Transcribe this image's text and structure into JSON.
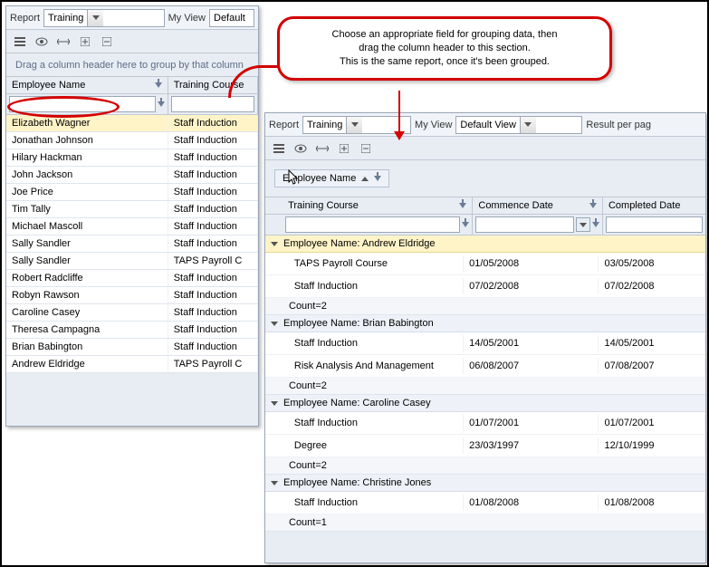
{
  "callout": {
    "line1": "Choose an appropriate field for grouping data, then",
    "line2": "drag the column header to this section.",
    "line3": "This is the same report, once it's been grouped."
  },
  "left": {
    "report_label": "Report",
    "report_value": "Training",
    "myview_label": "My View",
    "myview_value": "Default",
    "group_hint": "Drag a column header here to group by that column",
    "col_employee": "Employee Name",
    "col_course": "Training Course",
    "rows": [
      {
        "name": "Elizabeth Wagner",
        "course": "Staff Induction"
      },
      {
        "name": "Jonathan Johnson",
        "course": "Staff Induction"
      },
      {
        "name": "Hilary Hackman",
        "course": "Staff Induction"
      },
      {
        "name": "John Jackson",
        "course": "Staff Induction"
      },
      {
        "name": "Joe Price",
        "course": "Staff Induction"
      },
      {
        "name": "Tim Tally",
        "course": "Staff Induction"
      },
      {
        "name": "Michael Mascoll",
        "course": "Staff Induction"
      },
      {
        "name": "Sally Sandler",
        "course": "Staff Induction"
      },
      {
        "name": "Sally Sandler",
        "course": "TAPS Payroll C"
      },
      {
        "name": "Robert Radcliffe",
        "course": "Staff Induction"
      },
      {
        "name": "Robyn Rawson",
        "course": "Staff Induction"
      },
      {
        "name": "Caroline Casey",
        "course": "Staff Induction"
      },
      {
        "name": "Theresa Campagna",
        "course": "Staff Induction"
      },
      {
        "name": "Brian Babington",
        "course": "Staff Induction"
      },
      {
        "name": "Andrew Eldridge",
        "course": "TAPS Payroll C"
      }
    ]
  },
  "right": {
    "report_label": "Report",
    "report_value": "Training",
    "myview_label": "My View",
    "myview_value": "Default View",
    "resultpp": "Result per pag",
    "chip": "Employee Name",
    "col_course": "Training Course",
    "col_commence": "Commence Date",
    "col_completed": "Completed Date",
    "group_prefix": "Employee Name: ",
    "count_prefix": "Count=",
    "groups": [
      {
        "name": "Andrew Eldridge",
        "hl": true,
        "rows": [
          {
            "c": "TAPS Payroll Course",
            "d1": "01/05/2008",
            "d2": "03/05/2008"
          },
          {
            "c": "Staff Induction",
            "d1": "07/02/2008",
            "d2": "07/02/2008"
          }
        ],
        "count": 2
      },
      {
        "name": "Brian Babington",
        "rows": [
          {
            "c": "Staff Induction",
            "d1": "14/05/2001",
            "d2": "14/05/2001"
          },
          {
            "c": "Risk Analysis And Management",
            "d1": "06/08/2007",
            "d2": "07/08/2007"
          }
        ],
        "count": 2
      },
      {
        "name": "Caroline Casey",
        "rows": [
          {
            "c": "Staff Induction",
            "d1": "01/07/2001",
            "d2": "01/07/2001"
          },
          {
            "c": "Degree",
            "d1": "23/03/1997",
            "d2": "12/10/1999"
          }
        ],
        "count": 2
      },
      {
        "name": "Christine Jones",
        "rows": [
          {
            "c": "Staff Induction",
            "d1": "01/08/2008",
            "d2": "01/08/2008"
          }
        ],
        "count": 1
      }
    ]
  }
}
